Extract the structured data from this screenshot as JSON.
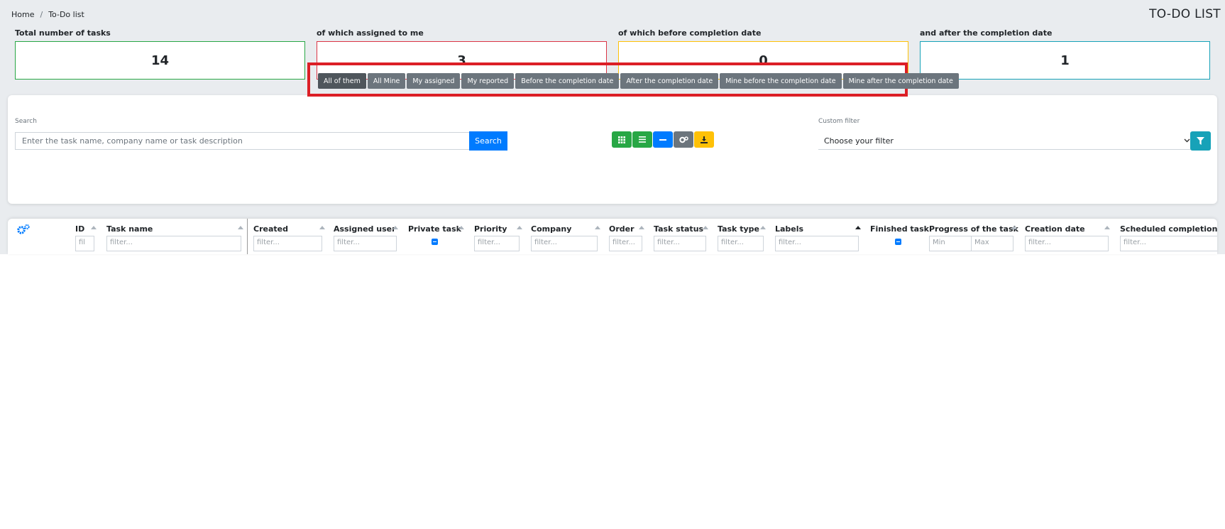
{
  "breadcrumb": {
    "home": "Home",
    "separator": "/",
    "current": "To-Do list"
  },
  "page_title": "TO-DO LIST",
  "stats": [
    {
      "label": "Total number of tasks",
      "value": "14",
      "color": "#28a745"
    },
    {
      "label": "of which assigned to me",
      "value": "3",
      "color": "#dc3545"
    },
    {
      "label": "of which before completion date",
      "value": "0",
      "color": "#ffc107"
    },
    {
      "label": "and after the completion date",
      "value": "1",
      "color": "#17a2b8"
    }
  ],
  "search": {
    "label": "Search",
    "placeholder": "Enter the task name, company name or task description",
    "button": "Search"
  },
  "view_buttons": [
    {
      "icon": "grid-icon",
      "color": "#28a745"
    },
    {
      "icon": "list-icon",
      "color": "#28a745"
    },
    {
      "icon": "minus-icon",
      "color": "#007bff"
    },
    {
      "icon": "cogs-icon",
      "color": "#6c757d"
    },
    {
      "icon": "download-icon",
      "color": "#ffc107"
    }
  ],
  "custom_filter": {
    "label": "Custom filter",
    "selected": "Choose your filter",
    "button_icon": "filter-icon"
  },
  "tabs": [
    {
      "label": "All of them",
      "active": true
    },
    {
      "label": "All Mine"
    },
    {
      "label": "My assigned"
    },
    {
      "label": "My reported"
    },
    {
      "label": "Before the completion date"
    },
    {
      "label": "After the completion date"
    },
    {
      "label": "Mine before the completion date"
    },
    {
      "label": "Mine after the completion date"
    }
  ],
  "table": {
    "settings_icon": "cogs-icon",
    "columns": [
      {
        "label": "ID",
        "filter": "fil"
      },
      {
        "label": "Task name",
        "filter": "filter..."
      },
      {
        "label": "Created",
        "filter": "filter..."
      },
      {
        "label": "Assigned user",
        "filter": "filter..."
      },
      {
        "label": "Private task"
      },
      {
        "label": "Priority",
        "filter": "filter..."
      },
      {
        "label": "Company",
        "filter": "filter..."
      },
      {
        "label": "Order",
        "filter": "filter..."
      },
      {
        "label": "Task status",
        "filter": "filter..."
      },
      {
        "label": "Task type",
        "filter": "filter..."
      },
      {
        "label": "Labels",
        "filter": "filter...",
        "sorted": "asc"
      },
      {
        "label": "Finished task"
      },
      {
        "label": "Progress of the task",
        "filter_min": "Min",
        "filter_max": "Max"
      },
      {
        "label": "Creation date",
        "filter": "filter..."
      },
      {
        "label": "Scheduled completion date",
        "filter": "filter..."
      }
    ]
  }
}
